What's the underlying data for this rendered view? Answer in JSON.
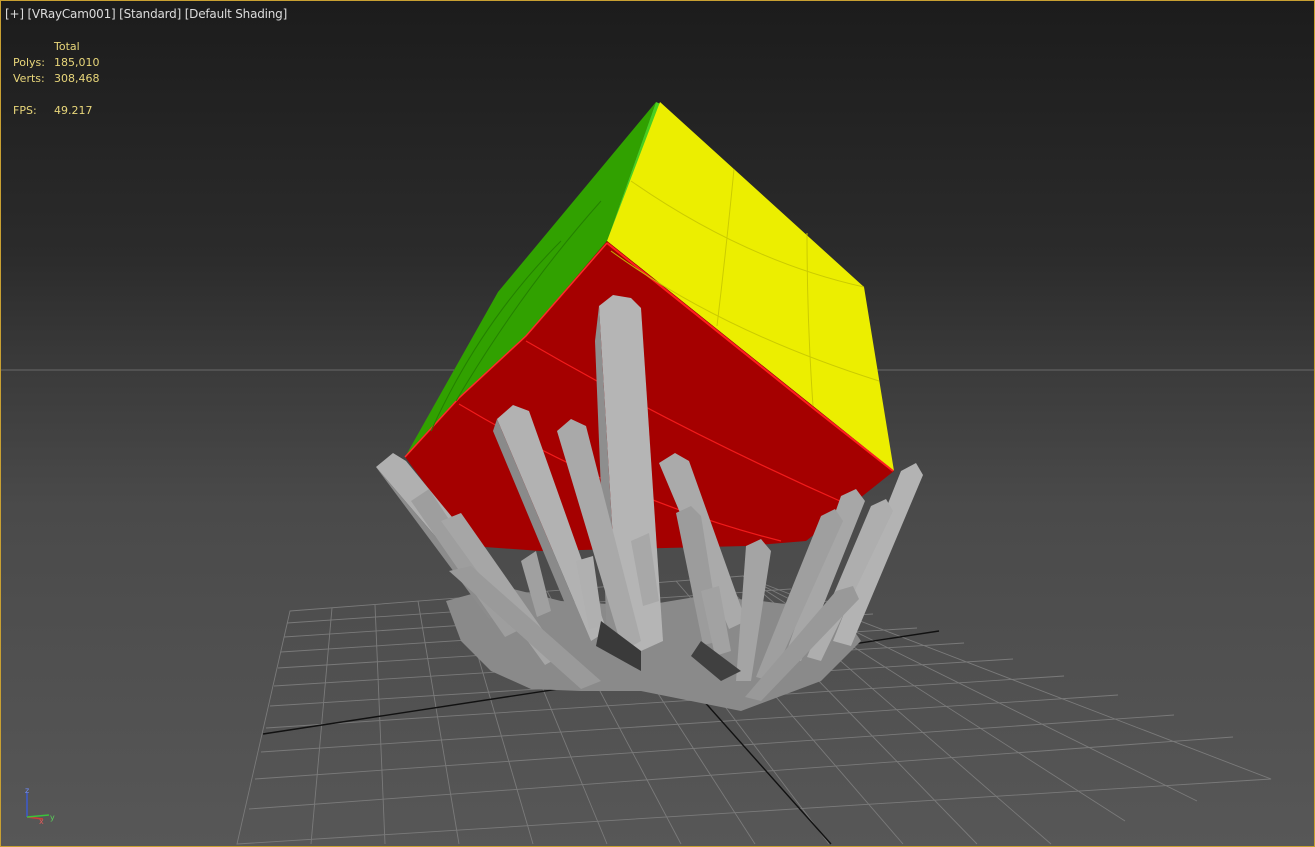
{
  "viewport": {
    "label_plus": "[+]",
    "label_camera": "[VRayCam001]",
    "label_mode": "[Standard]",
    "label_shading": "[Default Shading]"
  },
  "stats": {
    "header": "Total",
    "polys_label": "Polys:",
    "polys_value": "185,010",
    "verts_label": "Verts:",
    "verts_value": "308,468",
    "fps_label": "FPS:",
    "fps_value": "49.217"
  },
  "gizmo": {
    "z_label": "z",
    "x_label": "x",
    "y_label": "y"
  },
  "colors": {
    "frame_border": "#c8a032",
    "stats_text": "#e8d67a",
    "cube_yellow": "#ecee00",
    "cube_red": "#a50000",
    "cube_green": "#31a100",
    "crystal_gray": "#a8a8a8"
  }
}
